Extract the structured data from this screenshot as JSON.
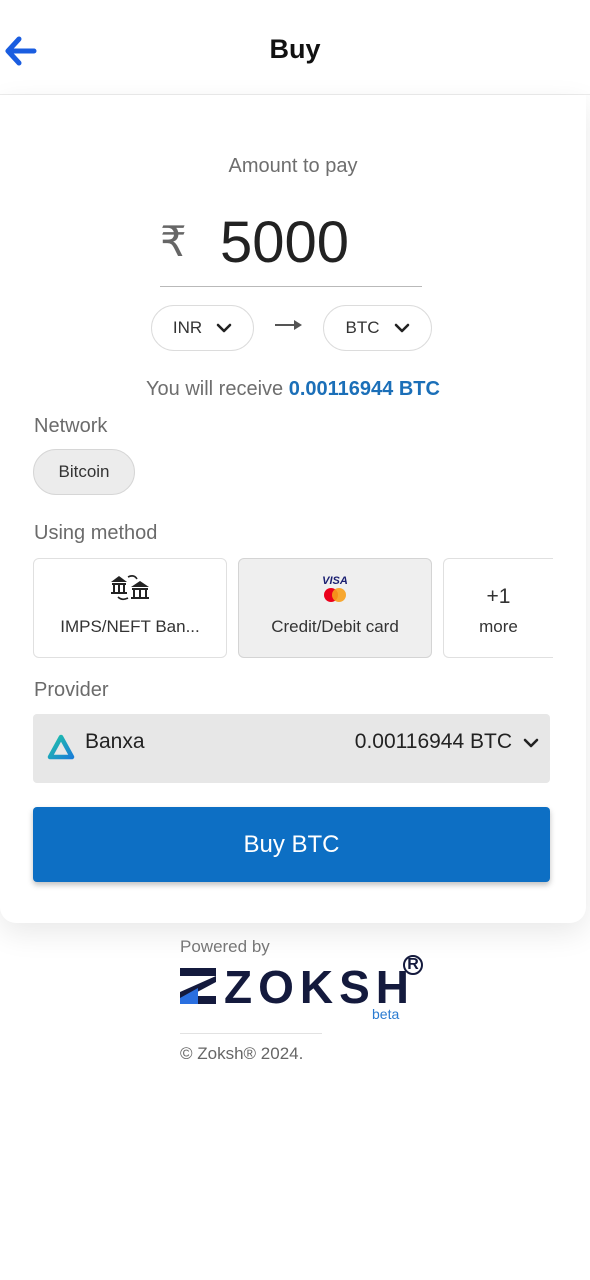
{
  "header": {
    "title": "Buy"
  },
  "amount": {
    "label": "Amount to pay",
    "currency_symbol": "₹",
    "value": "5000"
  },
  "conversion": {
    "from_currency": "INR",
    "to_currency": "BTC"
  },
  "receive": {
    "prefix": "You will receive",
    "amount": "0.00116944 BTC"
  },
  "network": {
    "label": "Network",
    "selected": "Bitcoin"
  },
  "method": {
    "label": "Using method",
    "options": [
      {
        "label": "IMPS/NEFT Ban...",
        "icon": "bank-transfer-icon"
      },
      {
        "label": "Credit/Debit card",
        "icon": "visa-card-icon",
        "badge": "VISA",
        "selected": true
      },
      {
        "count": "+1",
        "label": "more"
      }
    ]
  },
  "provider": {
    "label": "Provider",
    "name": "Banxa",
    "amount": "0.00116944 BTC"
  },
  "buy_button": {
    "label": "Buy BTC"
  },
  "footer": {
    "powered_by": "Powered by",
    "brand": "ZOKSH",
    "registered": "R",
    "beta": "beta",
    "copyright": "© Zoksh® 2024."
  },
  "colors": {
    "accent": "#0d6fc4",
    "back_arrow": "#1a5de0",
    "receive_amount": "#1b6fb8",
    "brand_navy": "#141a3d"
  }
}
